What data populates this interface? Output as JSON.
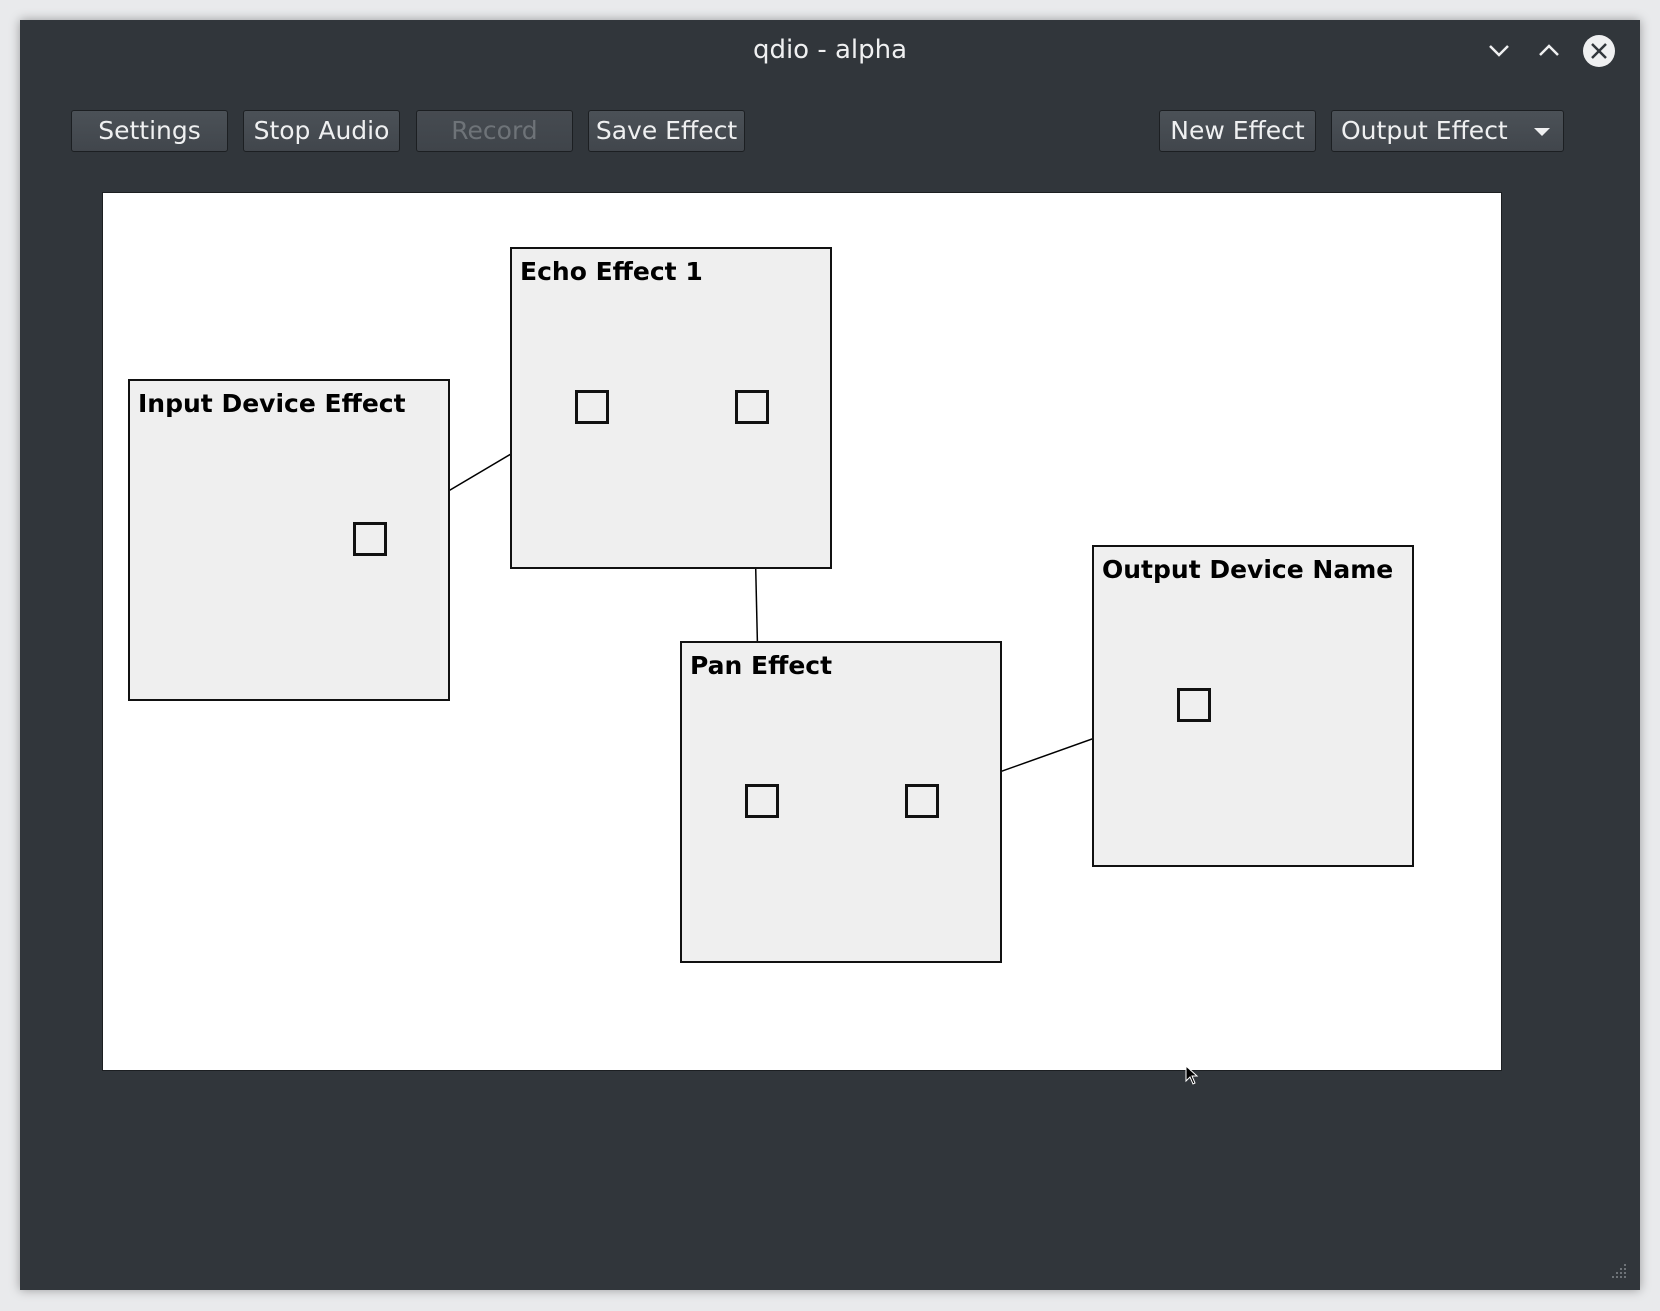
{
  "window": {
    "title": "qdio - alpha",
    "controls": [
      "minimize-icon",
      "maximize-icon",
      "close-icon"
    ]
  },
  "toolbar": {
    "settings_label": "Settings",
    "stop_audio_label": "Stop Audio",
    "record_label": "Record",
    "record_enabled": false,
    "save_effect_label": "Save Effect",
    "new_effect_label": "New Effect",
    "effect_type_selected": "Output Effect"
  },
  "canvas": {
    "nodes": [
      {
        "id": "input-device",
        "title": "Input Device Effect",
        "ports": [
          "output"
        ]
      },
      {
        "id": "echo",
        "title": "Echo Effect 1",
        "ports": [
          "input",
          "output"
        ]
      },
      {
        "id": "pan",
        "title": "Pan Effect",
        "ports": [
          "input",
          "output"
        ]
      },
      {
        "id": "output-device",
        "title": "Output Device Name",
        "ports": [
          "input"
        ]
      }
    ],
    "connections": [
      {
        "from": "input-device.output",
        "to": "echo.input"
      },
      {
        "from": "echo.output",
        "to": "pan.input"
      },
      {
        "from": "pan.output",
        "to": "output-device.input"
      }
    ]
  },
  "colors": {
    "window_bg": "#31363b",
    "button_bg": "#454a50",
    "button_text": "#eff0f1",
    "disabled_text": "#6e7378",
    "canvas_bg": "#ffffff",
    "node_bg": "#efefef"
  }
}
